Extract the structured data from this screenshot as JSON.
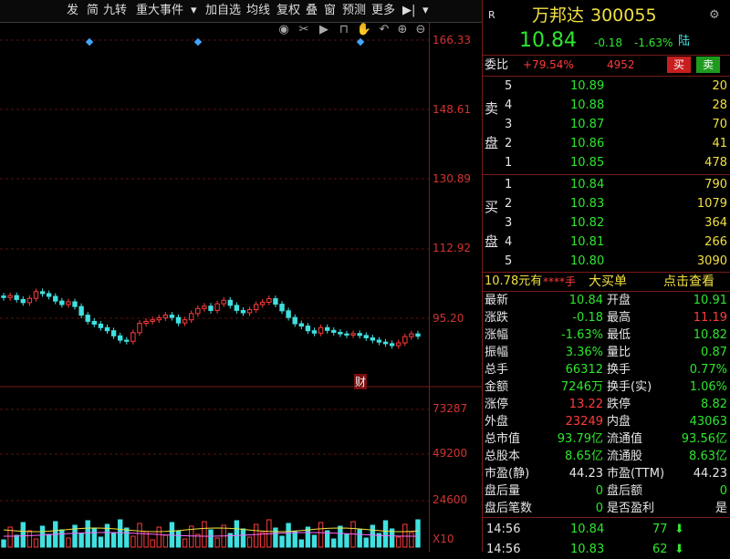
{
  "toolbar": {
    "items": [
      "发",
      "简",
      "九转",
      "重大事件",
      "▾",
      "加自选",
      "均线",
      "复权",
      "叠",
      "窗",
      "预测",
      "更多",
      "▶|",
      "▾"
    ]
  },
  "chart": {
    "price_labels": [
      "166.33",
      "148.61",
      "130.89",
      "112.92",
      "95.20"
    ],
    "volume_labels": [
      "73287",
      "49200",
      "24600"
    ],
    "volume_unit": "X10",
    "event_marker": "财"
  },
  "chart_data": {
    "type": "candlestick",
    "y_ticks": [
      166.33,
      148.61,
      130.89,
      112.92,
      95.2
    ],
    "volume_ticks": [
      73287,
      49200,
      24600
    ],
    "closes": [
      100.5,
      101,
      100,
      99.2,
      100.3,
      102,
      101.5,
      100.8,
      99.6,
      98.7,
      99.4,
      98.2,
      96,
      94.4,
      93.7,
      92.8,
      92,
      90.7,
      89.6,
      89.3,
      91.5,
      93.9,
      94.4,
      94.8,
      95.3,
      96,
      95.4,
      94,
      94.8,
      96.4,
      97.7,
      98.3,
      97.2,
      98.9,
      99.8,
      98.5,
      97.2,
      96.6,
      97.4,
      98.7,
      99.3,
      100.2,
      98.8,
      97.1,
      95.4,
      93.8,
      93.2,
      92,
      91.4,
      92.8,
      92.1,
      91.6,
      91.2,
      90.9,
      91.3,
      90.8,
      90.2,
      89.6,
      89.1,
      88.7,
      88.2,
      88.9,
      90.5,
      91.2,
      90.6
    ]
  },
  "panel": {
    "header": {
      "marker": "R",
      "name": "万邦达",
      "code": "300055"
    },
    "quote": {
      "price": "10.84",
      "change": "-0.18",
      "pct": "-1.63%",
      "tag": "陆"
    },
    "webi": {
      "label": "委比",
      "ratio": "+79.54%",
      "diff": "4952",
      "buy": "买",
      "sell": "卖"
    },
    "sell_label": [
      "卖",
      "盘"
    ],
    "buy_label": [
      "买",
      "盘"
    ],
    "asks": [
      {
        "lvl": "5",
        "price": "10.89",
        "vol": "20"
      },
      {
        "lvl": "4",
        "price": "10.88",
        "vol": "28"
      },
      {
        "lvl": "3",
        "price": "10.87",
        "vol": "70"
      },
      {
        "lvl": "2",
        "price": "10.86",
        "vol": "41"
      },
      {
        "lvl": "1",
        "price": "10.85",
        "vol": "478"
      }
    ],
    "bids": [
      {
        "lvl": "1",
        "price": "10.84",
        "vol": "790"
      },
      {
        "lvl": "2",
        "price": "10.83",
        "vol": "1079"
      },
      {
        "lvl": "3",
        "price": "10.82",
        "vol": "364"
      },
      {
        "lvl": "4",
        "price": "10.81",
        "vol": "266"
      },
      {
        "lvl": "5",
        "price": "10.80",
        "vol": "3090"
      }
    ],
    "bigbuy": {
      "left": "10.78元有",
      "mid": "****手",
      "center": "大买单",
      "right": "点击查看"
    },
    "stats": [
      {
        "l": "最新",
        "lv": "10.84",
        "lc": "green",
        "r": "开盘",
        "rv": "10.91",
        "rc": "green"
      },
      {
        "l": "涨跌",
        "lv": "-0.18",
        "lc": "green",
        "r": "最高",
        "rv": "11.19",
        "rc": "red"
      },
      {
        "l": "涨幅",
        "lv": "-1.63%",
        "lc": "green",
        "r": "最低",
        "rv": "10.82",
        "rc": "green"
      },
      {
        "l": "振幅",
        "lv": "3.36%",
        "lc": "green",
        "r": "量比",
        "rv": "0.87",
        "rc": "green"
      },
      {
        "l": "总手",
        "lv": "66312",
        "lc": "green",
        "r": "换手",
        "rv": "0.77%",
        "rc": "green"
      },
      {
        "l": "金额",
        "lv": "7246万",
        "lc": "green",
        "r": "换手(实)",
        "rv": "1.06%",
        "rc": "green"
      },
      {
        "l": "涨停",
        "lv": "13.22",
        "lc": "red",
        "r": "跌停",
        "rv": "8.82",
        "rc": "green"
      },
      {
        "l": "外盘",
        "lv": "23249",
        "lc": "red",
        "r": "内盘",
        "rv": "43063",
        "rc": "green"
      },
      {
        "l": "总市值",
        "lv": "93.79亿",
        "lc": "green",
        "r": "流通值",
        "rv": "93.56亿",
        "rc": "green"
      },
      {
        "l": "总股本",
        "lv": "8.65亿",
        "lc": "green",
        "r": "流通股",
        "rv": "8.63亿",
        "rc": "green"
      },
      {
        "l": "市盈(静)",
        "lv": "44.23",
        "lc": "white",
        "r": "市盈(TTM)",
        "rv": "44.23",
        "rc": "white"
      },
      {
        "l": "盘后量",
        "lv": "0",
        "lc": "green",
        "r": "盘后额",
        "rv": "0",
        "rc": "green"
      },
      {
        "l": "盘后笔数",
        "lv": "0",
        "lc": "green",
        "r": "是否盈利",
        "rv": "是",
        "rc": "white"
      }
    ],
    "ticks": [
      {
        "time": "14:56",
        "price": "10.84",
        "vol": "77",
        "dir": "down"
      },
      {
        "time": "14:56",
        "price": "10.83",
        "vol": "62",
        "dir": "down"
      }
    ]
  },
  "colors": {
    "up": "#ff3b3b",
    "down": "#40e0e0",
    "grid": "#5a1010",
    "accent": "#d23232"
  }
}
